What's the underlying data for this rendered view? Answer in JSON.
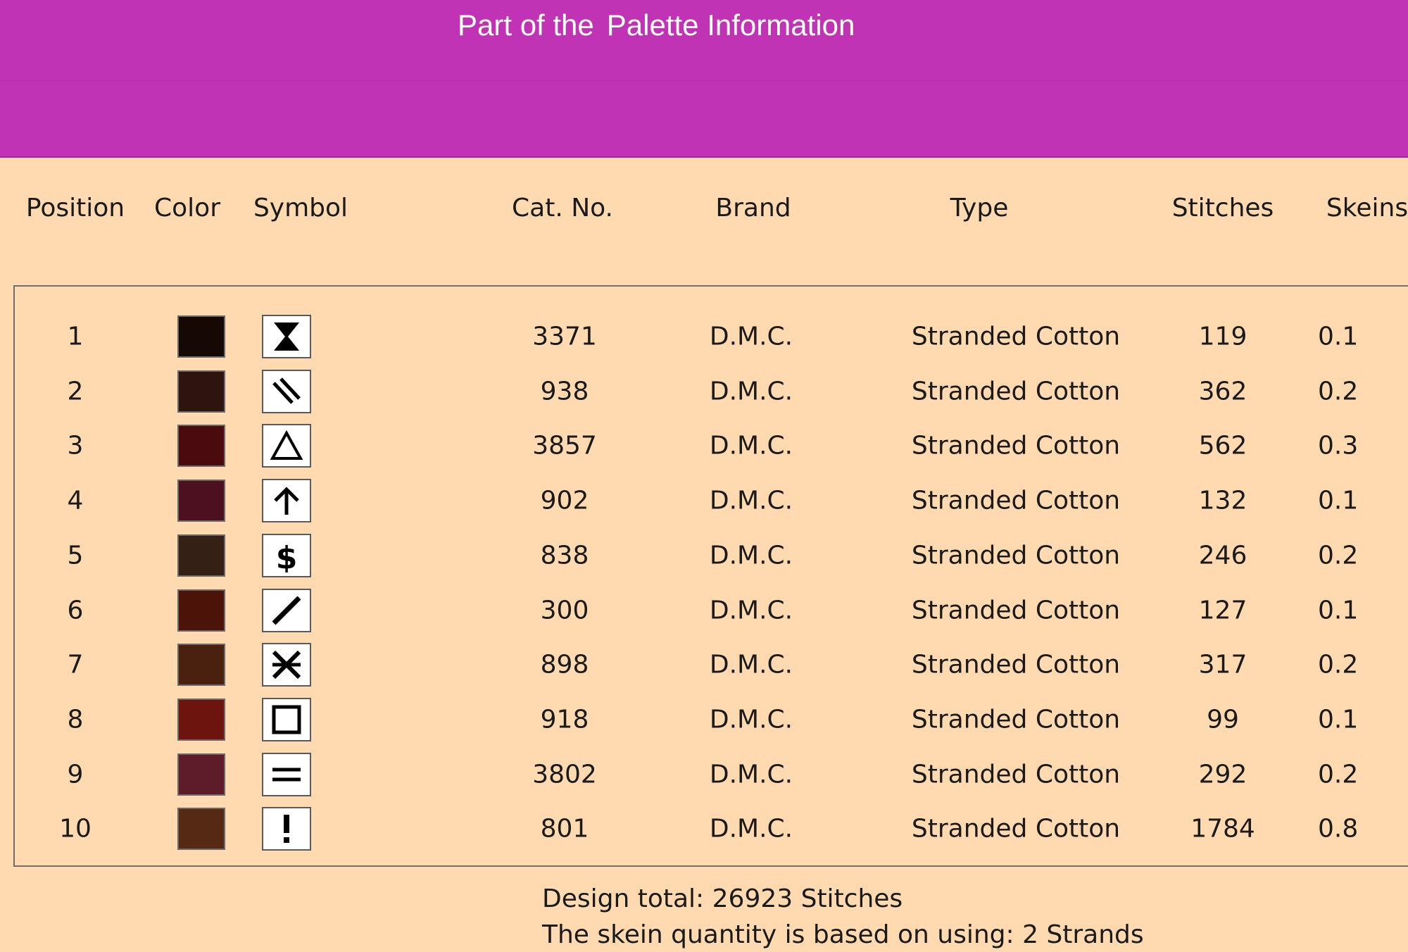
{
  "banner": {
    "prefix": "Part of the",
    "title": "Palette Information",
    "color": "#C133B5"
  },
  "background_color": "#FFDAB0",
  "columns": {
    "position": "Position",
    "color": "Color",
    "symbol": "Symbol",
    "cat_no": "Cat. No.",
    "brand": "Brand",
    "type": "Type",
    "stitches": "Stitches",
    "skeins": "Skeins"
  },
  "rows": [
    {
      "position": "1",
      "color": "#150805",
      "symbol": "hourglass-icon",
      "cat_no": "3371",
      "brand": "D.M.C.",
      "type": "Stranded Cotton",
      "stitches": "119",
      "skeins": "0.1"
    },
    {
      "position": "2",
      "color": "#2E130E",
      "symbol": "double-slash-icon",
      "cat_no": "938",
      "brand": "D.M.C.",
      "type": "Stranded Cotton",
      "stitches": "362",
      "skeins": "0.2"
    },
    {
      "position": "3",
      "color": "#4A0A0E",
      "symbol": "triangle-icon",
      "cat_no": "3857",
      "brand": "D.M.C.",
      "type": "Stranded Cotton",
      "stitches": "562",
      "skeins": "0.3"
    },
    {
      "position": "4",
      "color": "#4C1020",
      "symbol": "arrow-up-icon",
      "cat_no": "902",
      "brand": "D.M.C.",
      "type": "Stranded Cotton",
      "stitches": "132",
      "skeins": "0.1"
    },
    {
      "position": "5",
      "color": "#352016",
      "symbol": "dollar-icon",
      "cat_no": "838",
      "brand": "D.M.C.",
      "type": "Stranded Cotton",
      "stitches": "246",
      "skeins": "0.2"
    },
    {
      "position": "6",
      "color": "#4C1408",
      "symbol": "slash-icon",
      "cat_no": "300",
      "brand": "D.M.C.",
      "type": "Stranded Cotton",
      "stitches": "127",
      "skeins": "0.1"
    },
    {
      "position": "7",
      "color": "#4A200E",
      "symbol": "asterisk-cross-icon",
      "cat_no": "898",
      "brand": "D.M.C.",
      "type": "Stranded Cotton",
      "stitches": "317",
      "skeins": "0.2"
    },
    {
      "position": "8",
      "color": "#6E140E",
      "symbol": "square-icon",
      "cat_no": "918",
      "brand": "D.M.C.",
      "type": "Stranded Cotton",
      "stitches": "99",
      "skeins": "0.1"
    },
    {
      "position": "9",
      "color": "#5E1C2A",
      "symbol": "equals-icon",
      "cat_no": "3802",
      "brand": "D.M.C.",
      "type": "Stranded Cotton",
      "stitches": "292",
      "skeins": "0.2"
    },
    {
      "position": "10",
      "color": "#552914",
      "symbol": "exclamation-icon",
      "cat_no": "801",
      "brand": "D.M.C.",
      "type": "Stranded Cotton",
      "stitches": "1784",
      "skeins": "0.8"
    }
  ],
  "footer": {
    "design_total": "Design total: 26923 Stitches",
    "skein_note": "The skein quantity is based on using: 2 Strands"
  }
}
